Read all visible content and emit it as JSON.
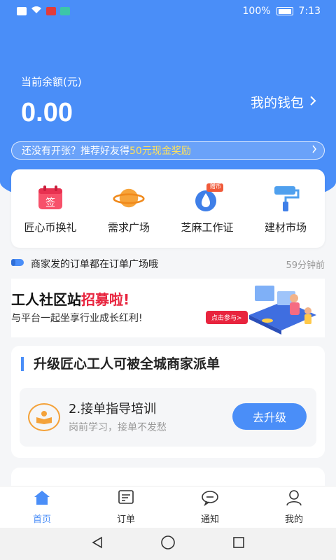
{
  "status_bar": {
    "battery": "100%",
    "time": "7:13"
  },
  "balance": {
    "label": "当前余额(元)",
    "amount": "0.00"
  },
  "wallet": {
    "label": "我的钱包",
    "chevron": ">"
  },
  "promo": {
    "text_before": "还没有开张？推荐好友得",
    "highlight": "50元现金奖励",
    "chevron": ">"
  },
  "quick_actions": [
    {
      "label": "匠心币换礼",
      "icon": "sign-calendar-icon"
    },
    {
      "label": "需求广场",
      "icon": "planet-icon"
    },
    {
      "label": "芝麻工作证",
      "icon": "water-drop-icon",
      "badge": "赠币"
    },
    {
      "label": "建材市场",
      "icon": "paint-roller-icon"
    }
  ],
  "notice": {
    "text": "商家发的订单都在订单广场哦",
    "time": "59分钟前"
  },
  "recruit": {
    "title_before": "工人社区站",
    "title_highlight": "招募啦!",
    "subtitle": "与平台一起坐享行业成长红利!",
    "button": "点击参与>"
  },
  "upgrade": {
    "title": "升级匠心工人可被全城商家派单",
    "training_title": "2.接单指导培训",
    "training_sub": "岗前学习，接单不发愁",
    "button": "去升级"
  },
  "tabs": [
    {
      "label": "首页",
      "icon": "home-icon",
      "active": true
    },
    {
      "label": "订单",
      "icon": "order-icon",
      "active": false
    },
    {
      "label": "通知",
      "icon": "chat-icon",
      "active": false
    },
    {
      "label": "我的",
      "icon": "user-icon",
      "active": false
    }
  ],
  "colors": {
    "primary": "#4a8ef8",
    "accent_red": "#e8243e",
    "highlight_yellow": "#ffe15a"
  }
}
